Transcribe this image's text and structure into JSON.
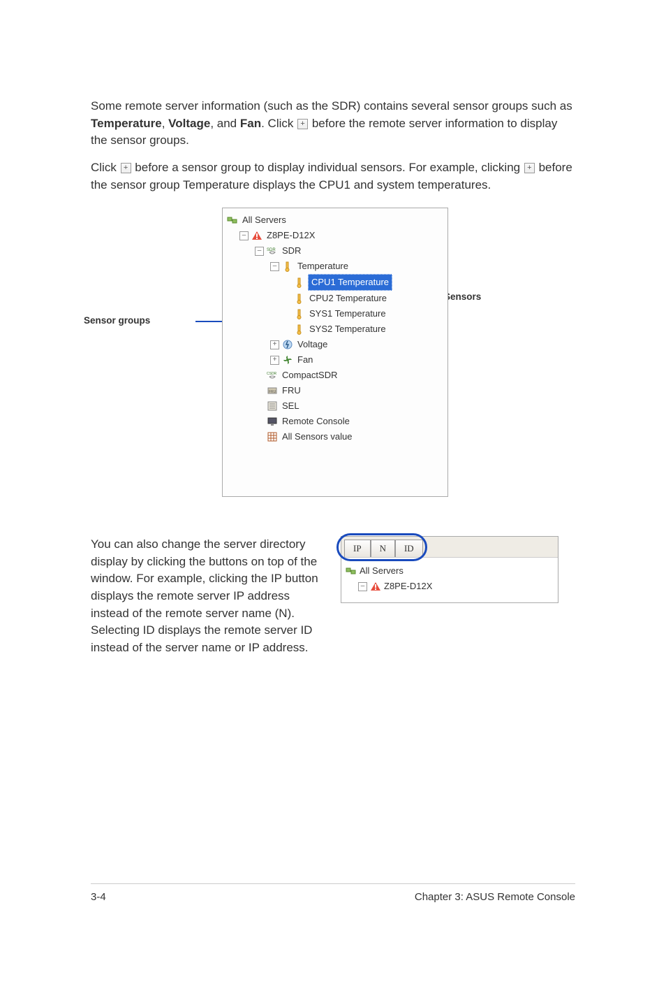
{
  "paragraphs": {
    "p1_a": "Some remote server information (such as the SDR) contains several sensor groups such as ",
    "p1_temp": "Temperature",
    "p1_sep1": ", ",
    "p1_volt": "Voltage",
    "p1_sep2": ", and ",
    "p1_fan": "Fan",
    "p1_b": ". Click ",
    "p1_c": " before the remote server information to display the sensor groups.",
    "p2_a": "Click ",
    "p2_b": " before a sensor group to display individual sensors. For example, clicking ",
    "p2_c": " before the sensor group Temperature displays the CPU1 and system temperatures.",
    "p3": "You can also change the server directory display by clicking the buttons on top of the window. For example, clicking the IP button displays the remote server IP address instead of the remote server name (N). Selecting ID displays the remote server ID instead of the server name or IP address."
  },
  "labels": {
    "sensor_groups": "Sensor groups",
    "sensors": "Sensors"
  },
  "tree": {
    "root": "All Servers",
    "server": "Z8PE-D12X",
    "sdr": "SDR",
    "temperature": "Temperature",
    "cpu1": "CPU1 Temperature",
    "cpu2": "CPU2 Temperature",
    "sys1": "SYS1 Temperature",
    "sys2": "SYS2 Temperature",
    "voltage": "Voltage",
    "fan": "Fan",
    "compactsdr": "CompactSDR",
    "fru": "FRU",
    "sel": "SEL",
    "remote_console": "Remote Console",
    "all_sensors": "All Sensors value"
  },
  "tabs": {
    "ip": "IP",
    "n": "N",
    "id": "ID",
    "all_servers": "All Servers",
    "server": "Z8PE-D12X"
  },
  "footer": {
    "left": "3-4",
    "right": "Chapter 3: ASUS Remote Console"
  },
  "plus": "+",
  "minus": "–"
}
